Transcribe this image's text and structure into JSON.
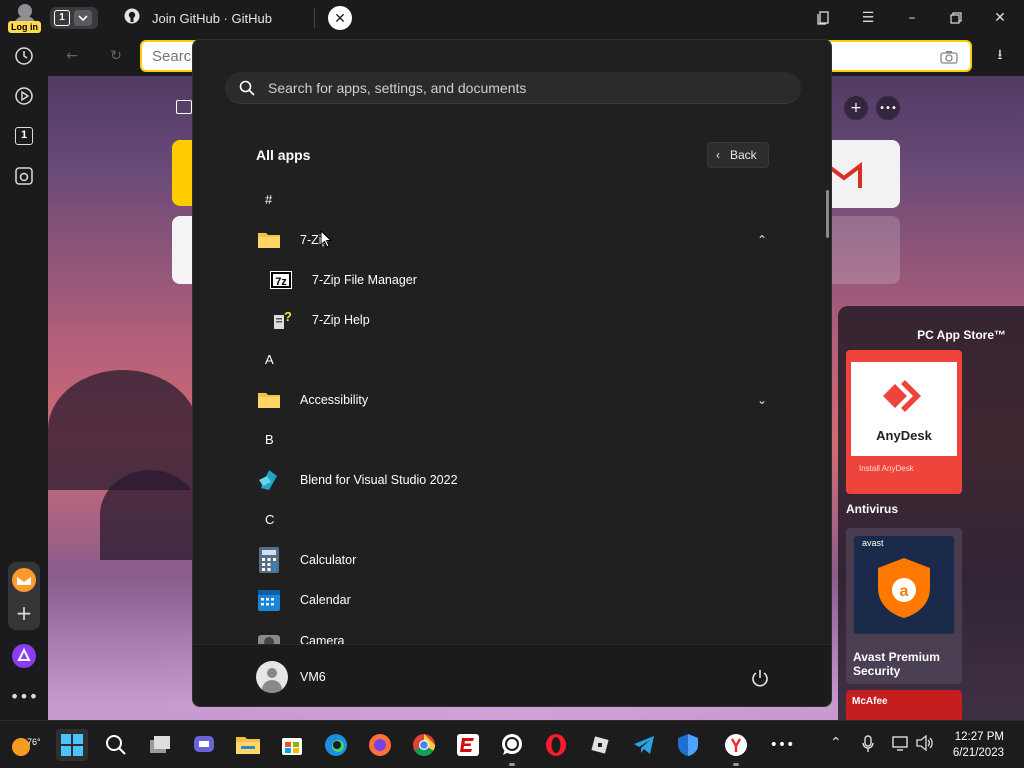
{
  "browser": {
    "login_label": "Log in",
    "tab_count": "1",
    "tab_title": "Join GitHub · GitHub",
    "address_placeholder": "Search",
    "sidebar_tabs_count": "1"
  },
  "store": {
    "header": "PC App Store™",
    "featured_name": "AnyDesk",
    "featured_action": "Install AnyDesk",
    "section": "Antivirus",
    "antivirus_brand": "avast",
    "antivirus_name": "Avast Premium Security",
    "next_brand": "McAfee"
  },
  "start_menu": {
    "search_placeholder": "Search for apps, settings, and documents",
    "section_title": "All apps",
    "back_label": "Back",
    "items": [
      {
        "kind": "letter",
        "label": "#"
      },
      {
        "kind": "folder",
        "label": "7-Zip",
        "expanded": true
      },
      {
        "kind": "sub",
        "label": "7-Zip File Manager",
        "icon": "7zip-icon"
      },
      {
        "kind": "sub",
        "label": "7-Zip Help",
        "icon": "help-file-icon"
      },
      {
        "kind": "letter",
        "label": "A"
      },
      {
        "kind": "folder",
        "label": "Accessibility",
        "expanded": false
      },
      {
        "kind": "letter",
        "label": "B"
      },
      {
        "kind": "app",
        "label": "Blend for Visual Studio 2022",
        "icon": "blend-icon"
      },
      {
        "kind": "letter",
        "label": "C"
      },
      {
        "kind": "app",
        "label": "Calculator",
        "icon": "calculator-icon"
      },
      {
        "kind": "app",
        "label": "Calendar",
        "icon": "calendar-icon"
      },
      {
        "kind": "app",
        "label": "Camera",
        "icon": "camera-icon"
      }
    ],
    "user_name": "VM6"
  },
  "taskbar": {
    "temperature": "76°",
    "time": "12:27 PM",
    "date": "6/21/2023"
  },
  "colors": {
    "accent": "#ffcc00",
    "start_bg": "#202020",
    "taskbar_bg": "#1c1c1c"
  }
}
